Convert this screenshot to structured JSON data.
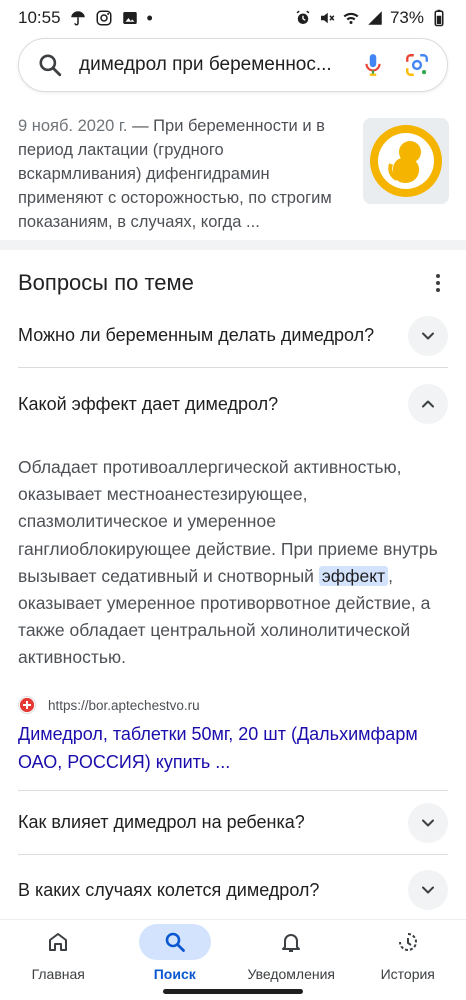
{
  "status_bar": {
    "time": "10:55",
    "battery": "73%",
    "dot": "•"
  },
  "search": {
    "query": "димедрол при беременнос..."
  },
  "top_result": {
    "date": "9 нояб. 2020 г.",
    "snippet": "— При беременности и в период лактации (грудного вскармливания) дифенгидрамин применяют с осторожностью, по строгим показаниям, в случаях, когда ..."
  },
  "questions": {
    "title": "Вопросы по теме",
    "items": [
      {
        "text": "Можно ли беременным делать димедрол?",
        "expanded": false
      },
      {
        "text": "Какой эффект дает димедрол?",
        "expanded": true
      },
      {
        "text": "Как влияет димедрол на ребенка?",
        "expanded": false
      },
      {
        "text": "В каких случаях колется димедрол?",
        "expanded": false
      }
    ],
    "answer": {
      "before": "Обладает противоаллергической активностью, оказывает местноанестезирующее, спазмолитическое и умеренное ганглиоблокирующее действие. При приеме внутрь вызывает седативный и снотворный ",
      "highlight": "эффект",
      "after": ", оказывает умеренное противорвотное действие, а также обладает центральной холинолитической активностью."
    },
    "source": {
      "url": "https://bor.aptechestvo.ru",
      "link_text": "Димедрол, таблетки 50мг, 20 шт (Дальхимфарм ОАО, РОССИЯ) купить ..."
    }
  },
  "bottom_nav": {
    "items": [
      {
        "label": "Главная",
        "icon": "home-icon",
        "active": false
      },
      {
        "label": "Поиск",
        "icon": "search-icon",
        "active": true
      },
      {
        "label": "Уведомления",
        "icon": "bell-icon",
        "active": false
      },
      {
        "label": "История",
        "icon": "history-icon",
        "active": false
      }
    ]
  },
  "colors": {
    "link": "#1a0dab",
    "highlight": "#d3e3fd",
    "active_nav": "#0b57d0",
    "thumbnail_accent": "#f4b400"
  }
}
